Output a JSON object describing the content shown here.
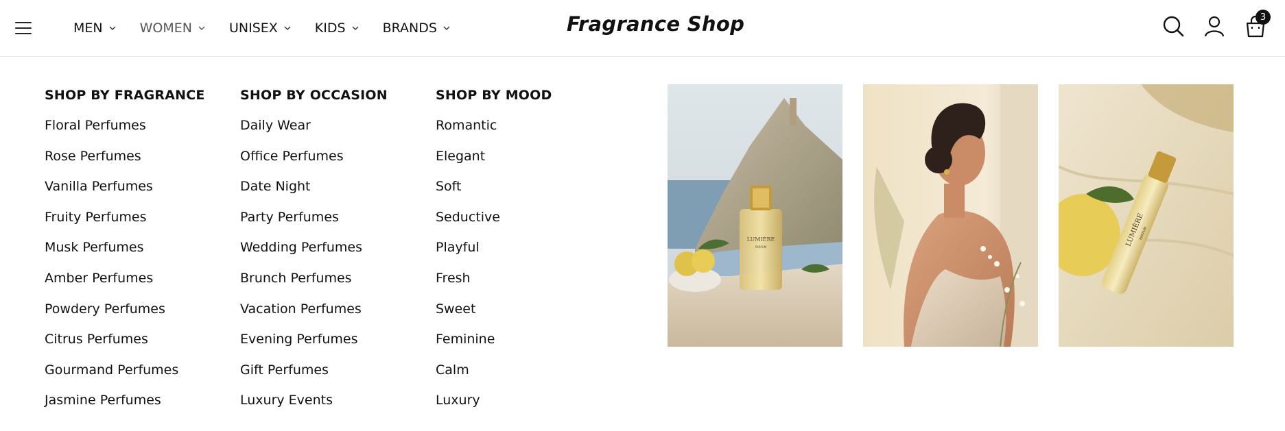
{
  "header": {
    "logo": "Fragrance Shop",
    "nav": [
      {
        "label": "MEN"
      },
      {
        "label": "WOMEN"
      },
      {
        "label": "UNISEX"
      },
      {
        "label": "KIDS"
      },
      {
        "label": "BRANDS"
      }
    ],
    "active_nav": "WOMEN",
    "cart_count": "3",
    "icons": [
      "menu-icon",
      "search-icon",
      "user-icon",
      "bag-icon"
    ]
  },
  "mega_menu": {
    "columns": [
      {
        "title": "SHOP BY FRAGRANCE",
        "items": [
          "Floral Perfumes",
          "Rose Perfumes",
          "Vanilla Perfumes",
          "Fruity Perfumes",
          "Musk Perfumes",
          "Amber Perfumes",
          "Powdery Perfumes",
          "Citrus Perfumes",
          "Gourmand Perfumes",
          "Jasmine Perfumes"
        ]
      },
      {
        "title": "SHOP BY OCCASION",
        "items": [
          "Daily Wear",
          "Office Perfumes",
          "Date Night",
          "Party Perfumes",
          "Wedding Perfumes",
          "Brunch Perfumes",
          "Vacation Perfumes",
          "Evening Perfumes",
          "Gift Perfumes",
          "Luxury Events"
        ]
      },
      {
        "title": "SHOP BY MOOD",
        "items": [
          "Romantic",
          "Elegant",
          "Soft",
          "Seductive",
          "Playful",
          "Fresh",
          "Sweet",
          "Feminine",
          "Calm",
          "Luxury"
        ]
      }
    ],
    "promo_images": [
      {
        "name": "coastal-perfume-bottle-image",
        "bottle_text": "LUMIÈRE",
        "bottle_subtext": "PARFUM"
      },
      {
        "name": "woman-in-silk-dress-image"
      },
      {
        "name": "lemon-perfume-spray-image",
        "bottle_text": "LUMIÈRE",
        "bottle_subtext": "PARFUM"
      }
    ]
  },
  "colors": {
    "text": "#111111",
    "divider": "#e6e6e6",
    "badge": "#111111"
  }
}
